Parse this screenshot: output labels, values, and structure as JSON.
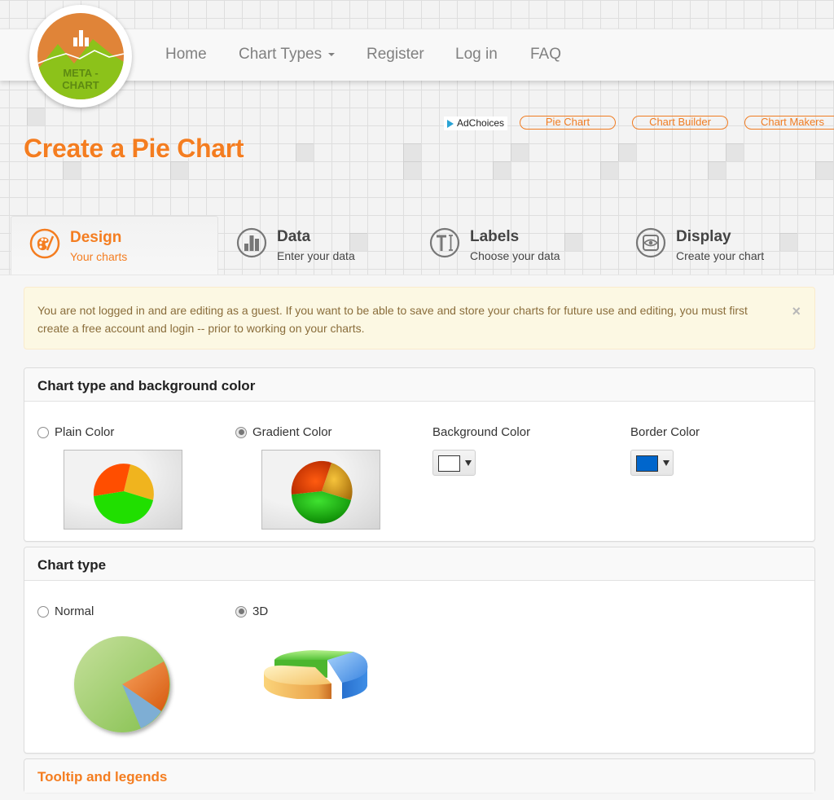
{
  "logo": {
    "line1": "META -",
    "line2": "CHART",
    "icon": "bar-chart-logo-icon"
  },
  "nav": {
    "items": [
      {
        "label": "Home"
      },
      {
        "label": "Chart Types",
        "has_dropdown": true
      },
      {
        "label": "Register"
      },
      {
        "label": "Log in"
      },
      {
        "label": "FAQ"
      }
    ]
  },
  "ads": {
    "adchoices_label": "AdChoices",
    "links": [
      "Pie Chart",
      "Chart Builder",
      "Chart Makers"
    ]
  },
  "page_title": "Create a Pie Chart",
  "tabs": [
    {
      "title": "Design",
      "subtitle": "Your charts",
      "icon": "palette-icon",
      "active": true
    },
    {
      "title": "Data",
      "subtitle": "Enter your data",
      "icon": "bar-chart-icon",
      "active": false
    },
    {
      "title": "Labels",
      "subtitle": "Choose your data",
      "icon": "text-cursor-icon",
      "active": false
    },
    {
      "title": "Display",
      "subtitle": "Create your chart",
      "icon": "eye-display-icon",
      "active": false
    }
  ],
  "alert": {
    "text": "You are not logged in and are editing as a guest. If you want to be able to save and store your charts for future use and editing, you must first create a free account and login -- prior to working on your charts.",
    "close": "×"
  },
  "panel_bg": {
    "title": "Chart type and background color",
    "options": [
      {
        "label": "Plain Color",
        "checked": false
      },
      {
        "label": "Gradient Color",
        "checked": true
      }
    ],
    "background_color": {
      "label": "Background Color",
      "value": "#ffffff"
    },
    "border_color": {
      "label": "Border Color",
      "value": "#0066cc"
    }
  },
  "panel_type": {
    "title": "Chart type",
    "options": [
      {
        "label": "Normal",
        "checked": false
      },
      {
        "label": "3D",
        "checked": true
      }
    ]
  },
  "panel_tooltip": {
    "title": "Tooltip and legends"
  },
  "colors": {
    "accent": "#f47d20",
    "alert_bg": "#fcf8e3",
    "alert_text": "#8a6d3b"
  }
}
